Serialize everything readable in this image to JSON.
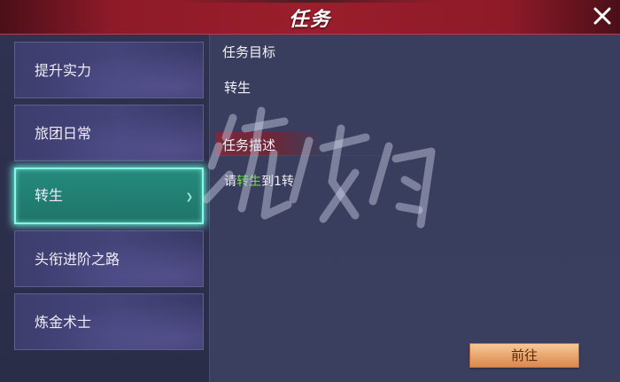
{
  "header": {
    "title": "任务"
  },
  "icons": {
    "close": "close-icon",
    "tab_arrow": "chevron-right-icon"
  },
  "tabs": [
    {
      "label": "提升实力",
      "selected": false
    },
    {
      "label": "旅团日常",
      "selected": false
    },
    {
      "label": "转生",
      "selected": true
    },
    {
      "label": "头衔进阶之路",
      "selected": false
    },
    {
      "label": "炼金术士",
      "selected": false
    }
  ],
  "detail": {
    "goal_label": "任务目标",
    "goal_value": "转生",
    "desc_label": "任务描述",
    "desc_prefix": "请",
    "desc_highlight": "转生",
    "desc_suffix": "到1转",
    "goto_label": "前往"
  },
  "colors": {
    "header": "#9a1e2c",
    "selected_tab": "#248a7d",
    "selected_glow": "#7ffbe8",
    "highlight_text": "#6fe05a",
    "button": "#e8a46a"
  }
}
